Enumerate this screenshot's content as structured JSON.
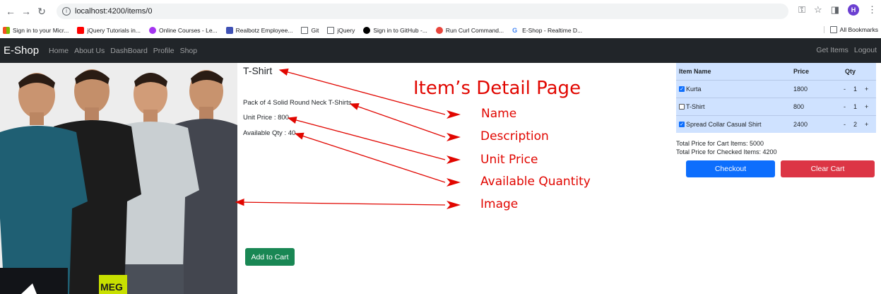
{
  "browser": {
    "url": "localhost:4200/items/0",
    "avatar_letter": "H",
    "bookmarks": [
      {
        "label": "Sign in to your Micr...",
        "color": "#f25022"
      },
      {
        "label": "jQuery Tutorials in...",
        "color": "#ff0000"
      },
      {
        "label": "Online Courses - Le...",
        "color": "#a435f0"
      },
      {
        "label": "Realbotz Employee...",
        "color": "#3f51b5"
      },
      {
        "label": "Git",
        "color": "folder"
      },
      {
        "label": "jQuery",
        "color": "folder"
      },
      {
        "label": "Sign in to GitHub -...",
        "color": "#000000"
      },
      {
        "label": "Run Curl Command...",
        "color": "#e8453c"
      },
      {
        "label": "E-Shop - Realtime D...",
        "color": "google"
      }
    ],
    "all_bookmarks": "All Bookmarks"
  },
  "navbar": {
    "brand": "E-Shop",
    "links": [
      "Home",
      "About Us",
      "DashBoard",
      "Profile",
      "Shop"
    ],
    "right_links": [
      "Get Items",
      "Logout"
    ]
  },
  "product": {
    "name": "T-Shirt",
    "description": "Pack of 4 Solid Round Neck T-Shirts",
    "unit_price": "Unit Price : 800",
    "available_qty": "Available Qty : 40",
    "add_to_cart": "Add to Cart",
    "image_shirt_colors": [
      "#1f5f73",
      "#1c1c1c",
      "#c9cfd2",
      "#43464f"
    ]
  },
  "annotations": {
    "title": "Item’s Detail Page",
    "labels": [
      "Name",
      "Description",
      "Unit Price",
      "Available Quantity",
      "Image"
    ],
    "color": "#e10600"
  },
  "cart": {
    "headers": {
      "name": "Item Name",
      "price": "Price",
      "qty": "Qty"
    },
    "rows": [
      {
        "name": "Kurta",
        "price": "1800",
        "qty": "1",
        "checked": true
      },
      {
        "name": "T-Shirt",
        "price": "800",
        "qty": "1",
        "checked": false
      },
      {
        "name": "Spread Collar Casual Shirt",
        "price": "2400",
        "qty": "2",
        "checked": true
      }
    ],
    "minus": "-",
    "plus": "+",
    "total_cart": "Total Price for Cart Items: 5000",
    "total_checked": "Total Price for Checked Items: 4200",
    "checkout": "Checkout",
    "clear": "Clear Cart"
  }
}
